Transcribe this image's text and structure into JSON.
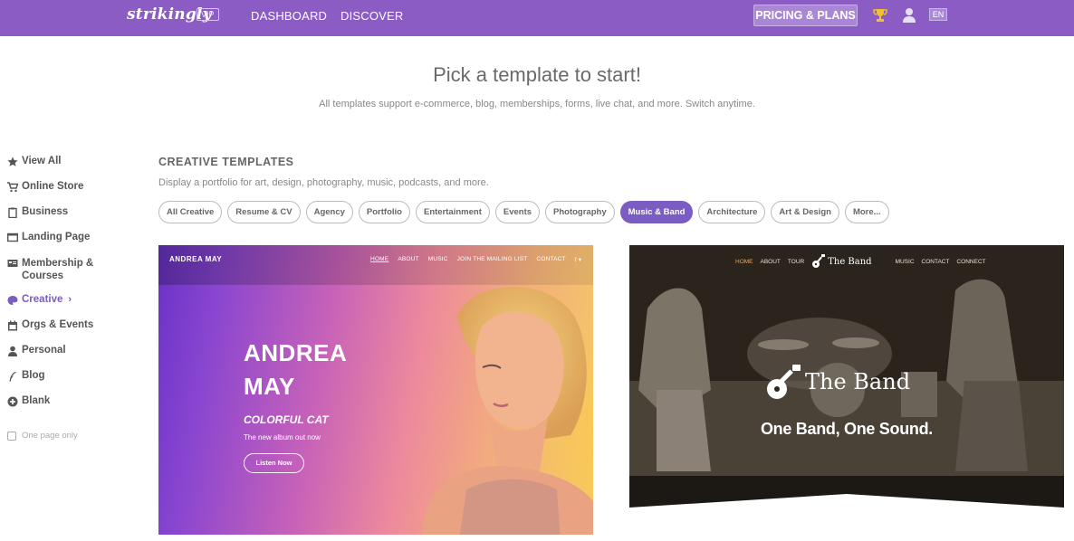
{
  "header": {
    "logo": "strikingly",
    "vip_badge": "VIP",
    "nav": [
      "DASHBOARD",
      "DISCOVER"
    ],
    "pricing_label": "PRICING & PLANS",
    "lang": "EN",
    "bg_color": "#8a5cc4"
  },
  "page": {
    "title": "Pick a template to start!",
    "subtitle": "All templates support e-commerce, blog, memberships, forms, live chat, and more. Switch anytime."
  },
  "sidebar": {
    "items": [
      {
        "label": "View All",
        "icon": "star-icon"
      },
      {
        "label": "Online Store",
        "icon": "cart-icon"
      },
      {
        "label": "Business",
        "icon": "briefcase-icon"
      },
      {
        "label": "Landing Page",
        "icon": "monitor-icon"
      },
      {
        "label": "Membership &",
        "label2": "Courses",
        "icon": "membership-icon"
      },
      {
        "label": "Creative",
        "icon": "palette-icon",
        "active": true
      },
      {
        "label": "Orgs & Events",
        "icon": "calendar-icon"
      },
      {
        "label": "Personal",
        "icon": "person-icon"
      },
      {
        "label": "Blog",
        "icon": "quill-icon"
      },
      {
        "label": "Blank",
        "icon": "plus-circle-icon"
      }
    ],
    "one_page_label": "One page only"
  },
  "section": {
    "title": "CREATIVE TEMPLATES",
    "subtitle": "Display a portfolio for art, design, photography, music, podcasts, and more.",
    "filters": [
      "All Creative",
      "Resume & CV",
      "Agency",
      "Portfolio",
      "Entertainment",
      "Events",
      "Photography",
      "Music & Band",
      "Architecture",
      "Art & Design",
      "More..."
    ],
    "active_filter": "Music & Band",
    "accent_color": "#7b5cc2"
  },
  "templates": [
    {
      "brand": "ANDREA MAY",
      "nav": [
        "HOME",
        "ABOUT",
        "MUSIC",
        "JOIN THE MAILING LIST",
        "CONTACT",
        "f ▾"
      ],
      "name_line1": "ANDREA",
      "name_line2": "MAY",
      "album": "COLORFUL CAT",
      "desc": "The new album out now",
      "button": "Listen Now"
    },
    {
      "nav_left": [
        "HOME",
        "ABOUT",
        "TOUR"
      ],
      "logo_small": "The Band",
      "nav_right": [
        "MUSIC",
        "CONTACT",
        "CONNECT"
      ],
      "logo": "The Band",
      "slogan": "One Band, One Sound."
    }
  ]
}
